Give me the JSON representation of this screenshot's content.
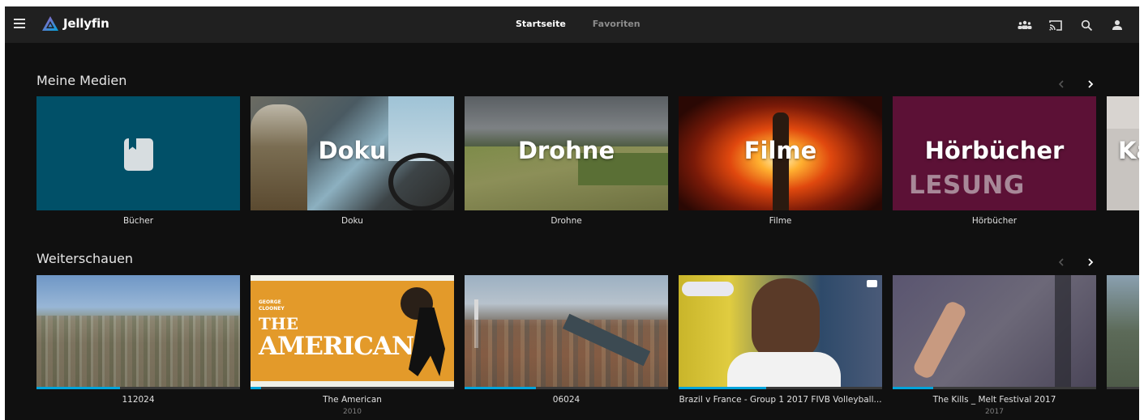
{
  "app": {
    "name": "Jellyfin",
    "accent": "#00a4dc"
  },
  "nav": {
    "tabs": [
      "Startseite",
      "Favoriten"
    ],
    "active": 0
  },
  "header_icons": [
    "group-icon",
    "cast-icon",
    "search-icon",
    "user-icon"
  ],
  "sections": {
    "media": {
      "title": "Meine Medien",
      "items": [
        {
          "label": "Bücher",
          "overlay": ""
        },
        {
          "label": "Doku",
          "overlay": "Doku"
        },
        {
          "label": "Drohne",
          "overlay": "Drohne"
        },
        {
          "label": "Filme",
          "overlay": "Filme"
        },
        {
          "label": "Hörbücher",
          "overlay": "Hörbücher",
          "overlay_sub": "LESUNG"
        },
        {
          "label": "",
          "overlay": "Ka"
        }
      ]
    },
    "continue": {
      "title": "Weiterschauen",
      "items": [
        {
          "label": "112024",
          "year": "",
          "progress": 0.41
        },
        {
          "label": "The American",
          "year": "2010",
          "progress": 0.05,
          "poster_line1": "GEORGE",
          "poster_line2": "CLOONEY",
          "poster_title1": "THE",
          "poster_title2": "AMERICAN"
        },
        {
          "label": "06024",
          "year": "",
          "progress": 0.35
        },
        {
          "label": "Brazil v France - Group 1 2017 FIVB Volleyball...",
          "year": "",
          "progress": 0.43
        },
        {
          "label": "The Kills _ Melt Festival 2017",
          "year": "2017",
          "progress": 0.2
        }
      ]
    }
  }
}
